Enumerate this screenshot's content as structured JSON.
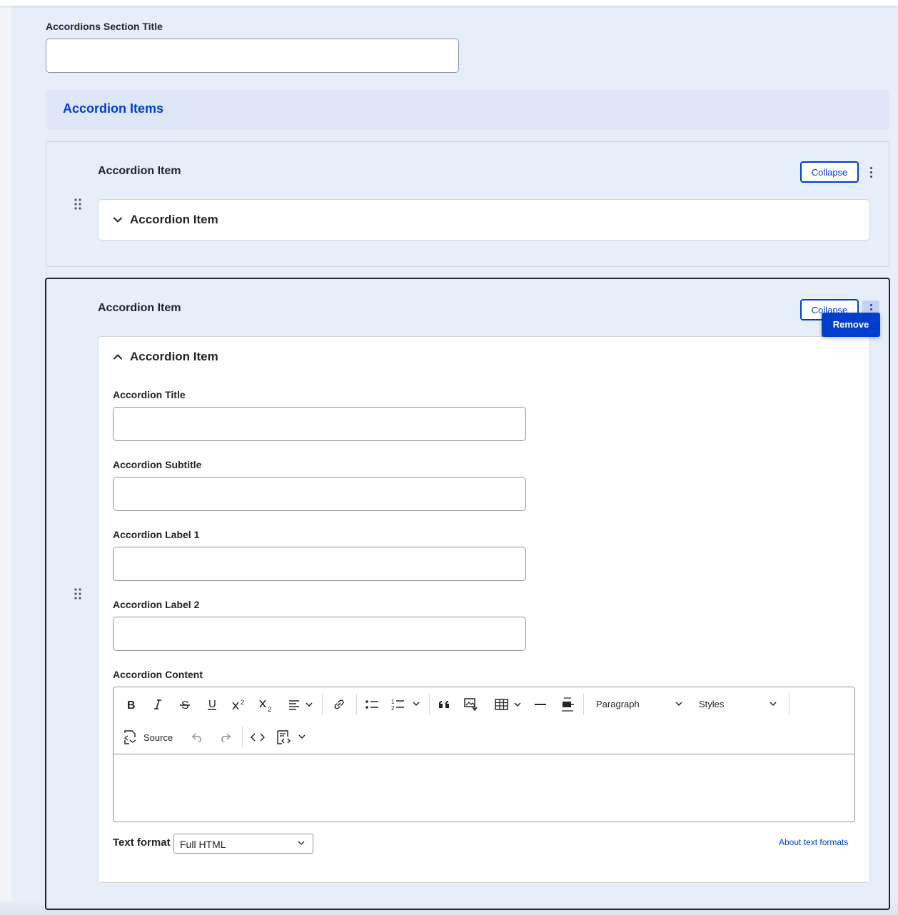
{
  "section_title_field": {
    "label": "Accordions Section Title",
    "value": ""
  },
  "accordion_items_heading": "Accordion Items",
  "items": [
    {
      "heading": "Accordion Item",
      "collapse_label": "Collapse",
      "summary": "Accordion Item",
      "expanded": false
    },
    {
      "heading": "Accordion Item",
      "collapse_label": "Collapse",
      "summary": "Accordion Item",
      "expanded": true,
      "menu": {
        "remove_label": "Remove"
      },
      "fields": {
        "title": {
          "label": "Accordion Title",
          "value": ""
        },
        "subtitle": {
          "label": "Accordion Subtitle",
          "value": ""
        },
        "label1": {
          "label": "Accordion Label 1",
          "value": ""
        },
        "label2": {
          "label": "Accordion Label 2",
          "value": ""
        }
      },
      "content": {
        "label": "Accordion Content",
        "toolbar": {
          "buttons": [
            "bold-icon",
            "italic-icon",
            "strikethrough-icon",
            "underline-icon",
            "superscript-icon",
            "subscript-icon",
            "align-icon",
            "link-icon",
            "bulleted-list-icon",
            "numbered-list-icon",
            "blockquote-icon",
            "image-icon",
            "table-icon",
            "horizontal-line-icon",
            "media-icon"
          ],
          "heading_dropdown": "Paragraph",
          "styles_dropdown": "Styles",
          "source_label": "Source",
          "row2_buttons": [
            "source-icon",
            "undo-icon",
            "redo-icon",
            "code-icon",
            "code-block-icon"
          ]
        },
        "value": ""
      },
      "text_format": {
        "label": "Text format",
        "selected": "Full HTML",
        "help_link": "About text formats"
      }
    }
  ],
  "colors": {
    "accent": "#003ecc",
    "panel_bg": "#e6eefa",
    "header_bg": "#dde7f8"
  }
}
